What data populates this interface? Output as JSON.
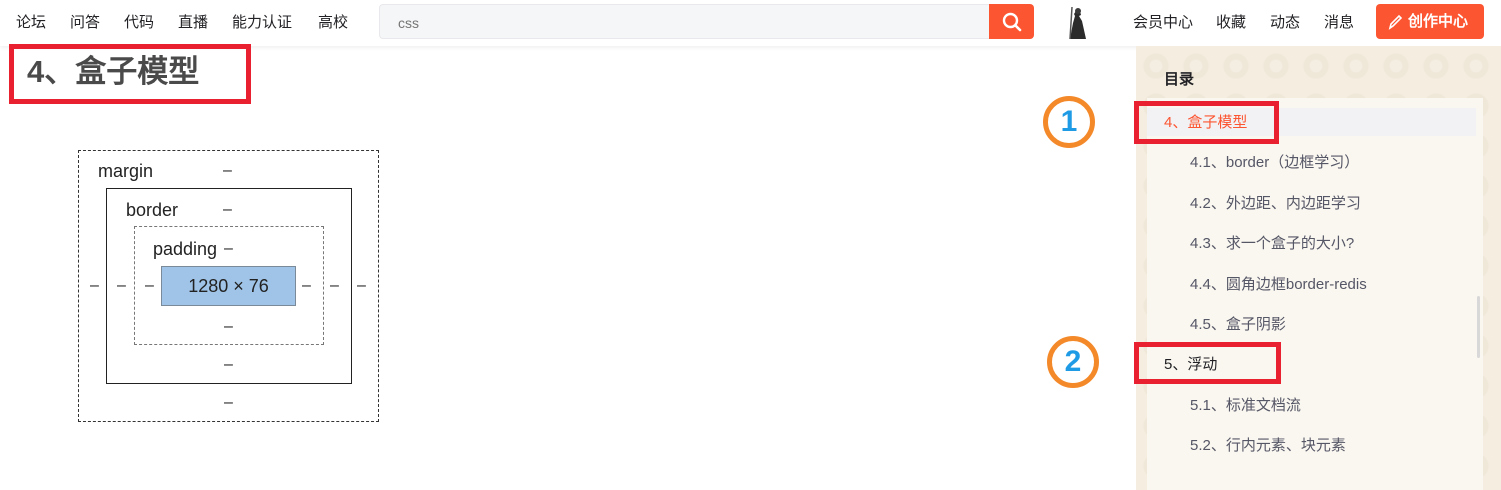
{
  "nav": {
    "left": [
      "论坛",
      "问答",
      "代码",
      "直播",
      "能力认证",
      "高校"
    ],
    "right": [
      "会员中心",
      "收藏",
      "动态",
      "消息"
    ],
    "create_label": "创作中心"
  },
  "search": {
    "value": "",
    "placeholder": "css"
  },
  "article": {
    "heading": "4、盒子模型"
  },
  "box_model": {
    "margin_label": "margin",
    "border_label": "border",
    "padding_label": "padding",
    "content_size": "1280 × 76",
    "empty_value": "–"
  },
  "toc": {
    "title": "目录",
    "items": [
      {
        "label": "4、盒子模型",
        "level": 1,
        "active": true
      },
      {
        "label": "4.1、border（边框学习）",
        "level": 2
      },
      {
        "label": "4.2、外边距、内边距学习",
        "level": 2
      },
      {
        "label": "4.3、求一个盒子的大小?",
        "level": 2
      },
      {
        "label": "4.4、圆角边框border-redis",
        "level": 2
      },
      {
        "label": "4.5、盒子阴影",
        "level": 2
      },
      {
        "label": "5、浮动",
        "level": 1
      },
      {
        "label": "5.1、标准文档流",
        "level": 2
      },
      {
        "label": "5.2、行内元素、块元素",
        "level": 2
      }
    ]
  },
  "annotations": {
    "marker_1": "1",
    "marker_2": "2"
  },
  "colors": {
    "accent": "#fc5531",
    "highlight_box": "#e8202f",
    "marker_ring": "#f4892a",
    "marker_digit": "#1f9be6"
  }
}
